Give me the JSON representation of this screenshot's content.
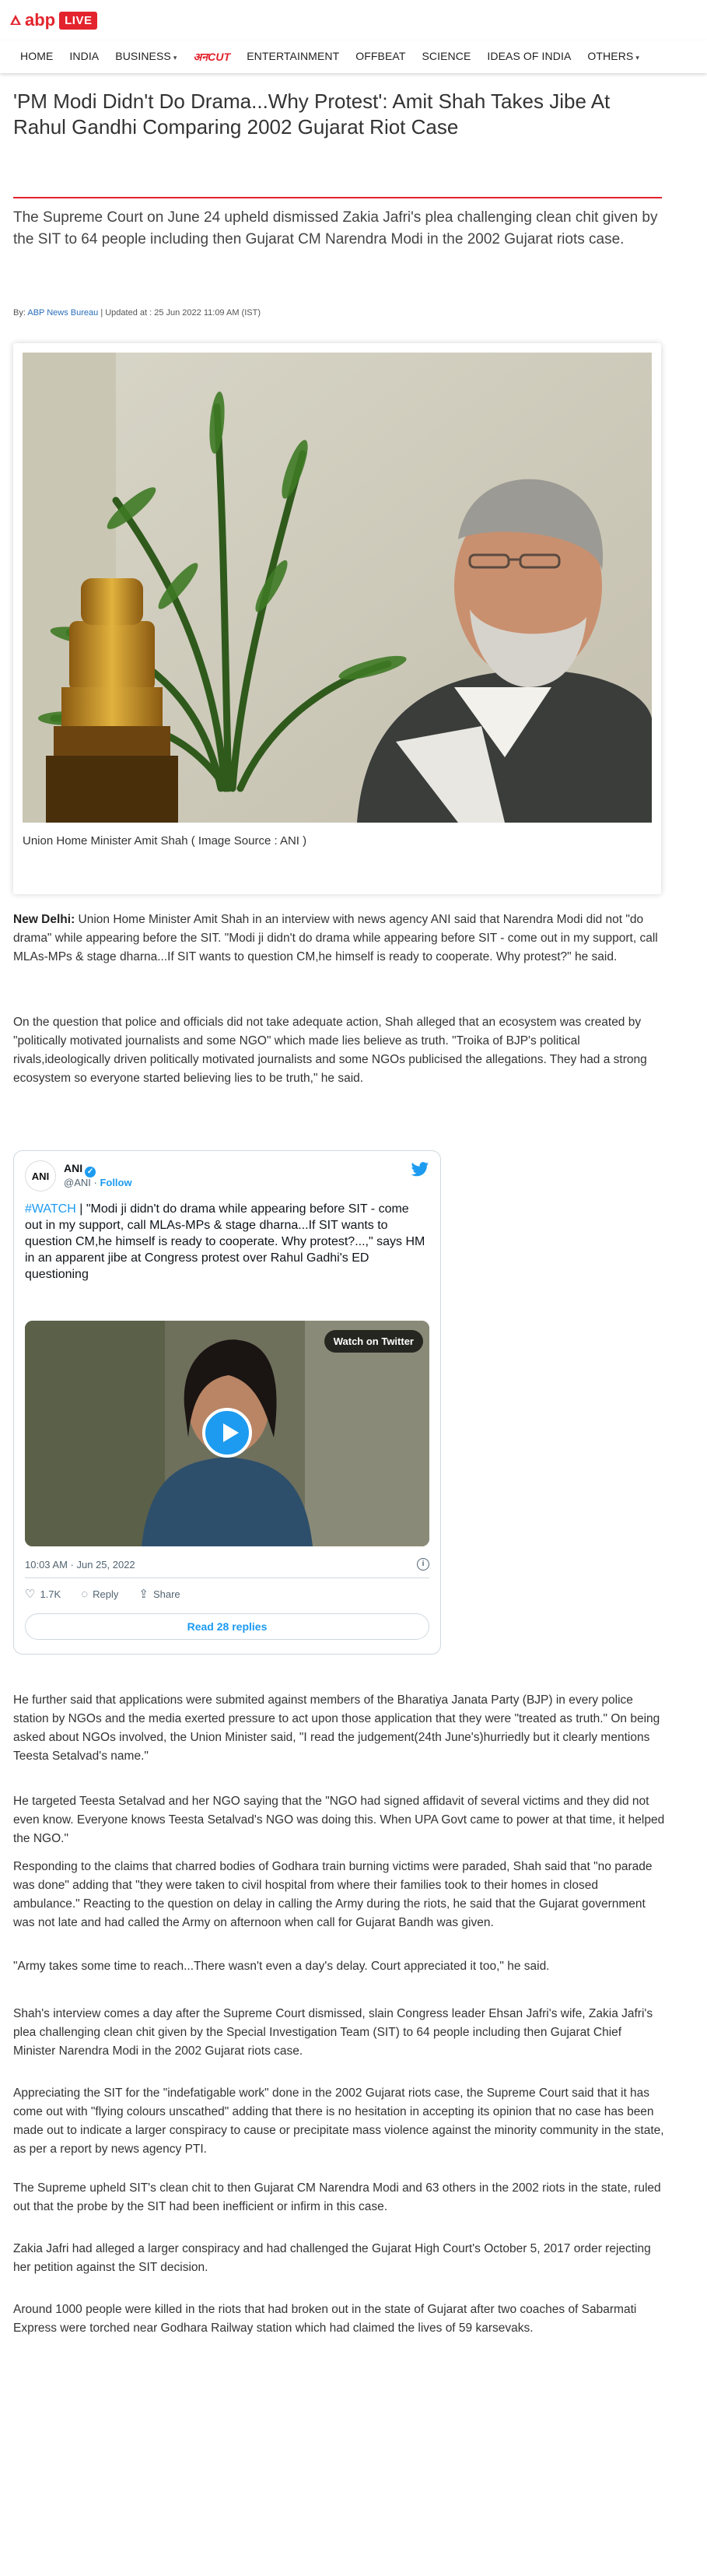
{
  "brand": {
    "name": "abp",
    "live": "LIVE",
    "accent": "#e3232d"
  },
  "nav": {
    "items": [
      {
        "label": "HOME",
        "dropdown": false
      },
      {
        "label": "INDIA",
        "dropdown": false
      },
      {
        "label": "BUSINESS",
        "dropdown": true
      },
      {
        "label": "अनCUT",
        "dropdown": false
      },
      {
        "label": "ENTERTAINMENT",
        "dropdown": false
      },
      {
        "label": "OFFBEAT",
        "dropdown": false
      },
      {
        "label": "SCIENCE",
        "dropdown": false
      },
      {
        "label": "IDEAS OF INDIA",
        "dropdown": false
      },
      {
        "label": "OTHERS",
        "dropdown": true
      }
    ]
  },
  "article": {
    "headline": "'PM Modi Didn't Do Drama...Why Protest': Amit Shah Takes Jibe At Rahul Gandhi Comparing 2002 Gujarat Riot Case",
    "subhead": "The Supreme Court on June 24 upheld dismissed Zakia Jafri's plea challenging clean chit given by the SIT to 64 people including then Gujarat CM Narendra Modi in the 2002 Gujarat riots case.",
    "byline": {
      "prefix": "By:",
      "author": "ABP News Bureau",
      "updated": "| Updated at : 25 Jun 2022 11:09 AM (IST)"
    },
    "image_caption": "Union Home Minister Amit Shah ( Image Source : ANI )",
    "p1_lead": "New Delhi:",
    "p1": " Union Home Minister Amit Shah in an interview with news agency ANI said that Narendra Modi did not \"do drama\" while appearing before the SIT.  \"Modi ji didn't do drama while appearing before SIT - come out in my support, call MLAs-MPs & stage dharna...If SIT wants to question CM,he himself is ready to cooperate. Why protest?\" he said.",
    "p2": "On the question that police and officials did not take adequate action, Shah alleged that an ecosystem was created by \"politically motivated journalists and some NGO\" which made lies believe as truth. \"Troika of BJP's political rivals,ideologically driven politically motivated journalists and some NGOs publicised the allegations. They had a strong ecosystem so everyone started believing lies to be truth,\" he said.",
    "p3": "He further said that applications were submited against members of the Bharatiya Janata Party (BJP) in every police station by NGOs and the media exerted pressure to act upon those application that they were \"treated as truth.\" On being asked about NGOs involved, the Union Minister said, \"I read the judgement(24th June's)hurriedly but it clearly mentions Teesta Setalvad's name.\"",
    "p4": "He targeted Teesta Setalvad and her NGO saying that the \"NGO had signed affidavit of several victims and they did not even know.  Everyone knows Teesta Setalvad's NGO was doing this. When UPA Govt came to power at that time, it helped the NGO.\"",
    "p5": "Responding to the claims that charred bodies of Godhara train burning victims were paraded, Shah said that \"no parade was done\" adding that \"they were taken to civil hospital from where their families took to their homes in closed ambulance.\" Reacting to the question on delay in calling the Army during the riots, he said that the Gujarat government was not late and had called the Army on afternoon when call for Gujarat Bandh was given.",
    "p6": "\"Army takes some time to reach...There wasn't even a day's delay. Court appreciated it too,\" he said.",
    "p7": "Shah's interview comes a day after the Supreme Court dismissed, slain Congress leader Ehsan Jafri's wife, Zakia Jafri's plea challenging clean chit given by the Special Investigation Team (SIT) to 64 people including then Gujarat Chief Minister Narendra Modi in the 2002 Gujarat riots case.",
    "p8": "Appreciating the SIT for the \"indefatigable work\" done in the 2002 Gujarat riots case, the Supreme Court said that it has come out with \"flying colours unscathed\" adding that there is no hesitation in accepting its opinion that no case has been made out to indicate a larger conspiracy to cause or precipitate mass violence against the minority community in the state, as per a report by news agency PTI.",
    "p9": "The Supreme  upheld SIT's clean chit to then Gujarat CM Narendra Modi and 63 others in the 2002 riots in the state, ruled out that the probe by the SIT had been inefficient or infirm in this case.",
    "p10": "Zakia Jafri had alleged a larger conspiracy and had challenged the Gujarat High Court's October 5, 2017 order rejecting her petition against the SIT decision.",
    "p11": "Around 1000 people were killed in the riots that had broken out in the state of Gujarat after two coaches of Sabarmati Express were torched near Godhara Railway station which had claimed the lives of 59 karsevaks."
  },
  "tweet": {
    "avatar_text": "ANI",
    "name": "ANI",
    "handle": "@ANI",
    "follow": "Follow",
    "hashtag": "#WATCH",
    "text": " | \"Modi ji didn't do drama while appearing before SIT - come out in my support, call MLAs-MPs & stage dharna...If SIT wants to question CM,he himself is ready to cooperate. Why protest?...,\" says HM in an apparent jibe at Congress protest over Rahul Gadhi's ED questioning",
    "watch_label": "Watch on Twitter",
    "timestamp": "10:03 AM · Jun 25, 2022",
    "likes": "1.7K",
    "reply_label": "Reply",
    "share_label": "Share",
    "replies_label": "Read 28 replies",
    "accent": "#1d9bf0"
  }
}
